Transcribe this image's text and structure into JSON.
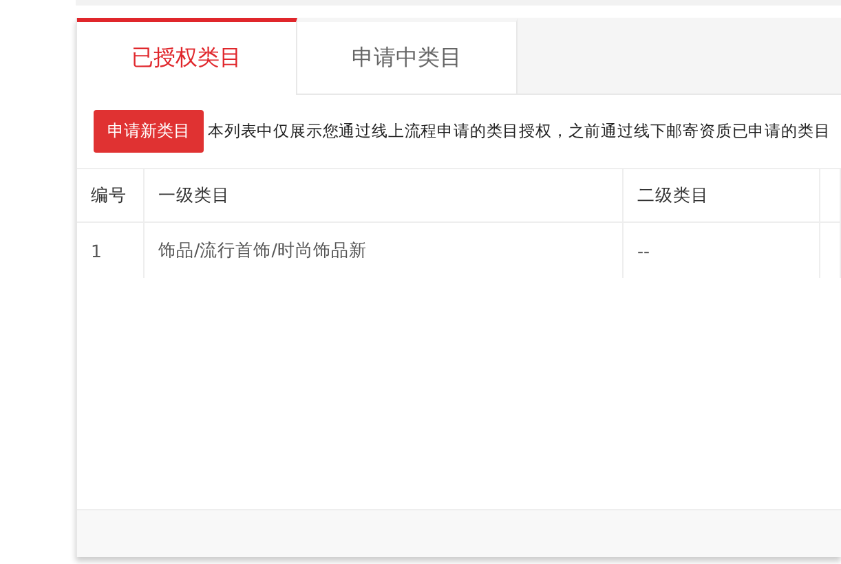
{
  "tabs": [
    {
      "label": "已授权类目",
      "selected": true
    },
    {
      "label": "申请中类目",
      "selected": false
    }
  ],
  "toolbar": {
    "button": "申请新类目",
    "notice": "本列表中仅展示您通过线上流程申请的类目授权，之前通过线下邮寄资质已申请的类目"
  },
  "table": {
    "columns": [
      "编号",
      "一级类目",
      "二级类目"
    ],
    "rows": [
      [
        "1",
        "饰品/流行首饰/时尚饰品新",
        "--"
      ]
    ]
  }
}
